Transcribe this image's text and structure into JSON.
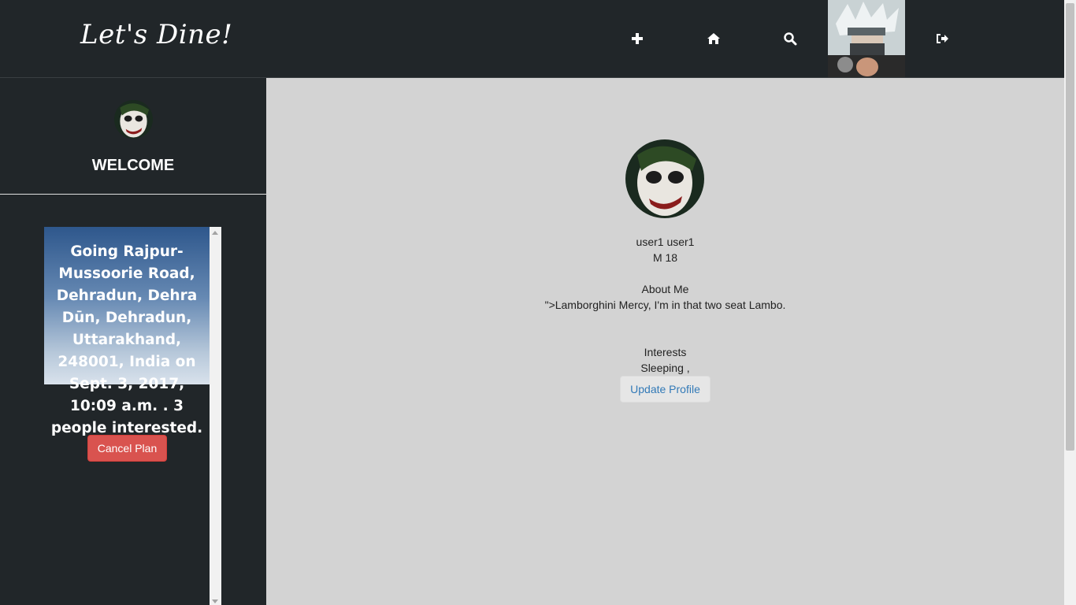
{
  "navbar": {
    "brand": "Let's Dine!",
    "icons": [
      {
        "name": "plus-icon"
      },
      {
        "name": "home-icon"
      },
      {
        "name": "search-icon"
      },
      {
        "name": "logout-icon"
      }
    ]
  },
  "sidebar": {
    "welcome": "WELCOME",
    "plan": {
      "text": "Going Rajpur-Mussoorie Road, Dehradun, Dehra Dūn, Dehradun, Uttarakhand, 248001, India on Sept. 3, 2017, 10:09 a.m. . 3 people interested.",
      "cancel_label": "Cancel Plan"
    }
  },
  "profile": {
    "name": "user1 user1",
    "gender_age": "M 18",
    "about_heading": "About Me",
    "about_text": "\">Lamborghini Mercy, I'm in that two seat Lambo.",
    "interests_heading": "Interests",
    "interests_text": "Sleeping ,",
    "update_label": "Update Profile"
  },
  "colors": {
    "navbar_bg": "#212629",
    "main_bg": "#d3d3d3",
    "cancel_button": "#d9534f",
    "link_blue": "#337ab7"
  }
}
